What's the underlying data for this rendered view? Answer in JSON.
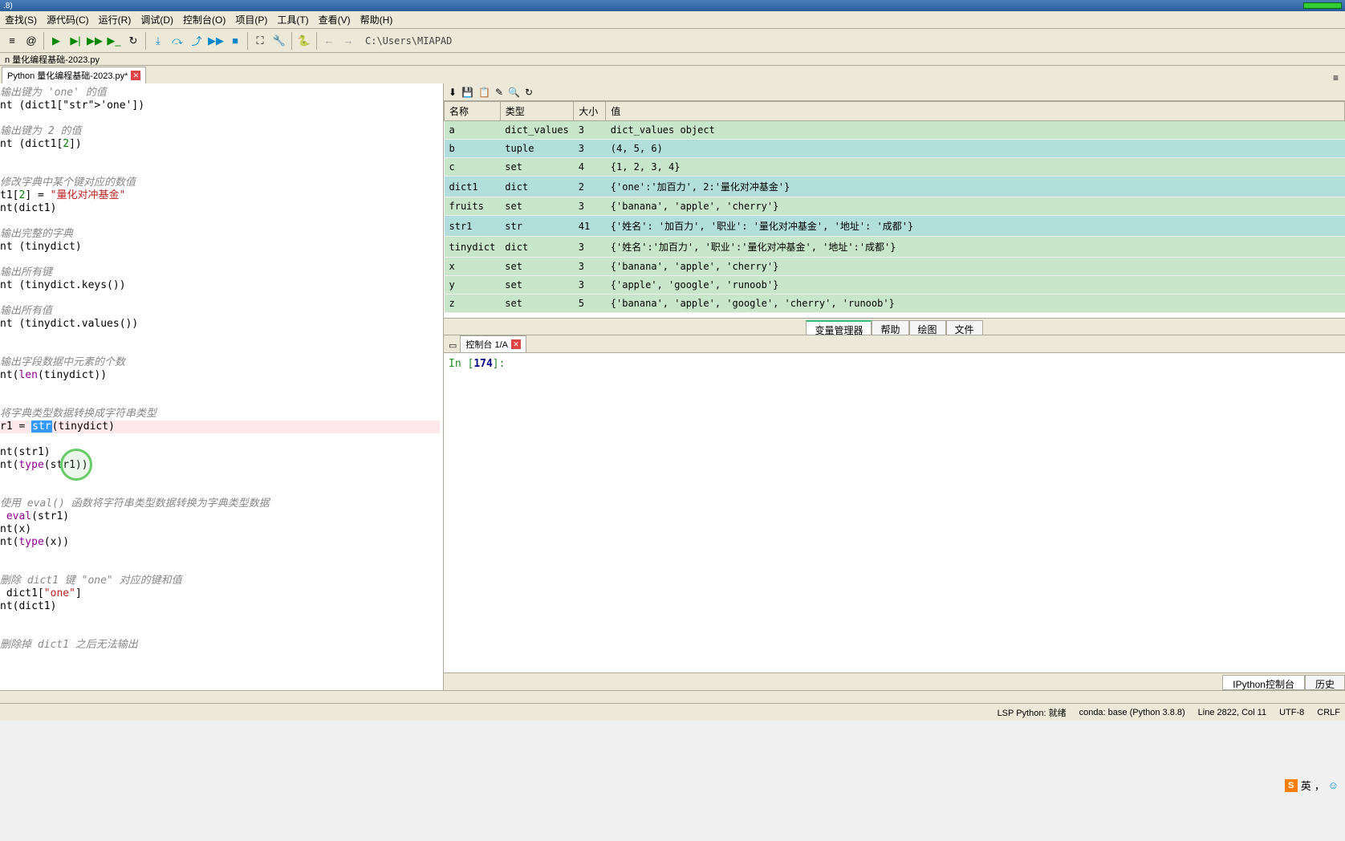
{
  "title_suffix": ".8)",
  "menu": [
    "查找(S)",
    "源代码(C)",
    "运行(R)",
    "调试(D)",
    "控制台(O)",
    "项目(P)",
    "工具(T)",
    "查看(V)",
    "帮助(H)"
  ],
  "path": "C:\\Users\\MIAPAD",
  "breadcrumb": "n 量化编程基础-2023.py",
  "filetab": "Python 量化编程基础-2023.py*",
  "code_lines": [
    {
      "t": "com",
      "v": "输出键为 'one' 的值"
    },
    {
      "t": "plain",
      "v": "nt (dict1['one'])"
    },
    {
      "t": "blank",
      "v": ""
    },
    {
      "t": "com",
      "v": "输出键为 2 的值"
    },
    {
      "t": "plain",
      "v": "nt (dict1[2])"
    },
    {
      "t": "blank",
      "v": ""
    },
    {
      "t": "blank",
      "v": ""
    },
    {
      "t": "com",
      "v": "修改字典中某个键对应的数值"
    },
    {
      "t": "plain",
      "v": "t1[2] = \"量化对冲基金\""
    },
    {
      "t": "plain",
      "v": "nt(dict1)"
    },
    {
      "t": "blank",
      "v": ""
    },
    {
      "t": "com",
      "v": "输出完整的字典"
    },
    {
      "t": "plain",
      "v": "nt (tinydict)"
    },
    {
      "t": "blank",
      "v": ""
    },
    {
      "t": "com",
      "v": "输出所有键"
    },
    {
      "t": "plain",
      "v": "nt (tinydict.keys())"
    },
    {
      "t": "blank",
      "v": ""
    },
    {
      "t": "com",
      "v": "输出所有值"
    },
    {
      "t": "plain",
      "v": "nt (tinydict.values())"
    },
    {
      "t": "blank",
      "v": ""
    },
    {
      "t": "blank",
      "v": ""
    },
    {
      "t": "com",
      "v": "输出字段数据中元素的个数"
    },
    {
      "t": "plain",
      "v": "nt(len(tinydict))"
    },
    {
      "t": "blank",
      "v": ""
    },
    {
      "t": "blank",
      "v": ""
    },
    {
      "t": "com",
      "v": "将字典类型数据转换成字符串类型"
    },
    {
      "t": "hl",
      "v": "r1 = str(tinydict)"
    },
    {
      "t": "plain",
      "v": "nt(str1)"
    },
    {
      "t": "plain",
      "v": "nt(type(str1))"
    },
    {
      "t": "blank",
      "v": ""
    },
    {
      "t": "blank",
      "v": ""
    },
    {
      "t": "com",
      "v": "使用 eval() 函数将字符串类型数据转换为字典类型数据"
    },
    {
      "t": "plain",
      "v": " eval(str1)"
    },
    {
      "t": "plain",
      "v": "nt(x)"
    },
    {
      "t": "plain",
      "v": "nt(type(x))"
    },
    {
      "t": "blank",
      "v": ""
    },
    {
      "t": "blank",
      "v": ""
    },
    {
      "t": "com",
      "v": "删除 dict1 键 \"one\" 对应的键和值"
    },
    {
      "t": "plain",
      "v": " dict1[\"one\"]"
    },
    {
      "t": "plain",
      "v": "nt(dict1)"
    },
    {
      "t": "blank",
      "v": ""
    },
    {
      "t": "blank",
      "v": ""
    },
    {
      "t": "com",
      "v": "删除掉 dict1 之后无法输出"
    }
  ],
  "var_headers": [
    "名称",
    "类型",
    "大小",
    "值"
  ],
  "variables": [
    {
      "name": "a",
      "type": "dict_values",
      "size": "3",
      "value": "dict_values object",
      "cls": "row-green"
    },
    {
      "name": "b",
      "type": "tuple",
      "size": "3",
      "value": "(4, 5, 6)",
      "cls": "row-teal"
    },
    {
      "name": "c",
      "type": "set",
      "size": "4",
      "value": "{1, 2, 3, 4}",
      "cls": "row-green"
    },
    {
      "name": "dict1",
      "type": "dict",
      "size": "2",
      "value": "{'one':'加百力', 2:'量化对冲基金'}",
      "cls": "row-teal"
    },
    {
      "name": "fruits",
      "type": "set",
      "size": "3",
      "value": "{'banana', 'apple', 'cherry'}",
      "cls": "row-green"
    },
    {
      "name": "str1",
      "type": "str",
      "size": "41",
      "value": "{'姓名': '加百力', '职业': '量化对冲基金', '地址': '成都'}",
      "cls": "row-teal"
    },
    {
      "name": "tinydict",
      "type": "dict",
      "size": "3",
      "value": "{'姓名':'加百力', '职业':'量化对冲基金', '地址':'成都'}",
      "cls": "row-green"
    },
    {
      "name": "x",
      "type": "set",
      "size": "3",
      "value": "{'banana', 'apple', 'cherry'}",
      "cls": "row-green"
    },
    {
      "name": "y",
      "type": "set",
      "size": "3",
      "value": "{'apple', 'google', 'runoob'}",
      "cls": "row-green"
    },
    {
      "name": "z",
      "type": "set",
      "size": "5",
      "value": "{'banana', 'apple', 'google', 'cherry', 'runoob'}",
      "cls": "row-green"
    }
  ],
  "var_tabs": [
    "变量管理器",
    "帮助",
    "绘图",
    "文件"
  ],
  "console_tab": "控制台 1/A",
  "console_prompt": "In [174]:",
  "bottom_tabs": [
    "IPython控制台",
    "历史"
  ],
  "status": {
    "lsp": "LSP Python: 就绪",
    "conda": "conda: base (Python 3.8.8)",
    "pos": "Line 2822, Col 11",
    "enc": "UTF-8",
    "eol": "CRLF"
  },
  "ime_lang": "英"
}
